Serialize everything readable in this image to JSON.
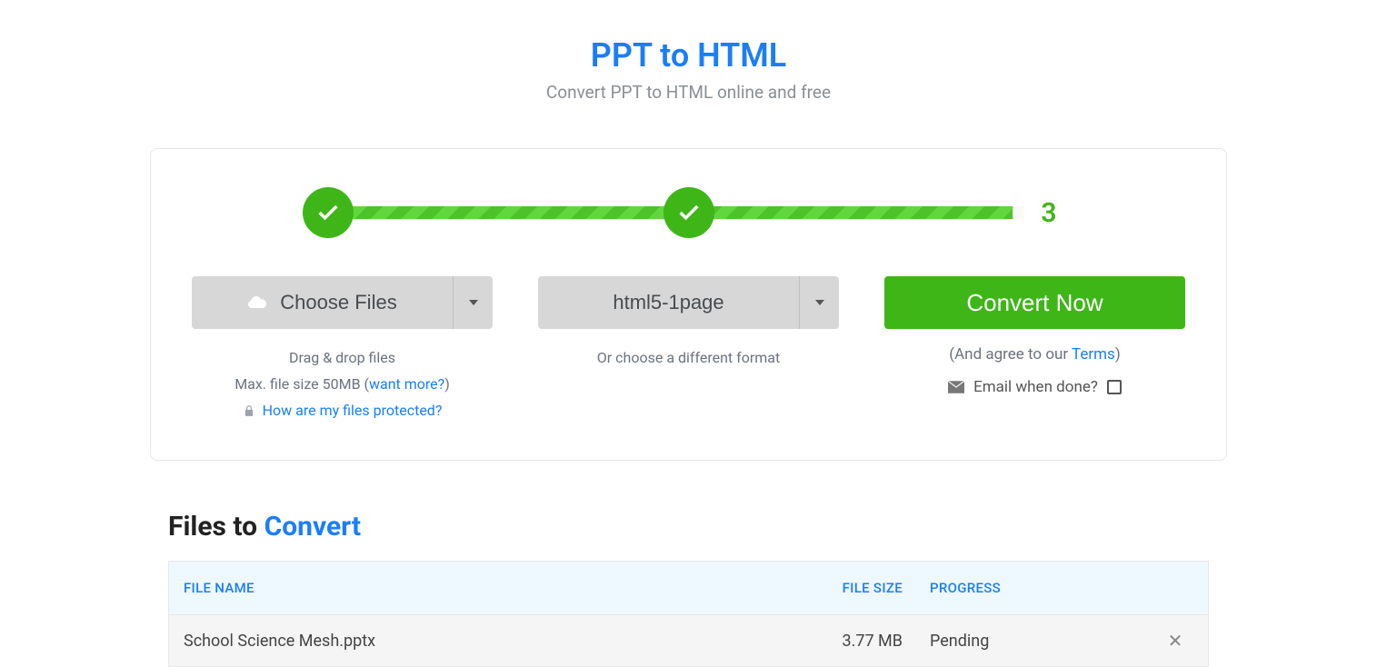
{
  "header": {
    "title": "PPT to HTML",
    "subtitle": "Convert PPT to HTML online and free"
  },
  "stepper": {
    "step3_label": "3"
  },
  "upload": {
    "choose_label": "Choose Files",
    "drag_text": "Drag & drop files",
    "max_size_prefix": "Max. file size 50MB (",
    "max_size_link": "want more?",
    "max_size_suffix": ")",
    "protected_link": "How are my files protected?"
  },
  "format": {
    "selected": "html5-1page",
    "or_text": "Or choose a different format"
  },
  "convert": {
    "button_label": "Convert Now",
    "agree_prefix": "(And agree to our ",
    "agree_link": "Terms",
    "agree_suffix": ")",
    "email_label": "Email when done?"
  },
  "files_section": {
    "title_prefix": "Files to ",
    "title_accent": "Convert",
    "columns": {
      "name": "FILE NAME",
      "size": "FILE SIZE",
      "progress": "PROGRESS"
    },
    "rows": [
      {
        "name": "School Science Mesh.pptx",
        "size": "3.77 MB",
        "progress": "Pending"
      }
    ]
  }
}
